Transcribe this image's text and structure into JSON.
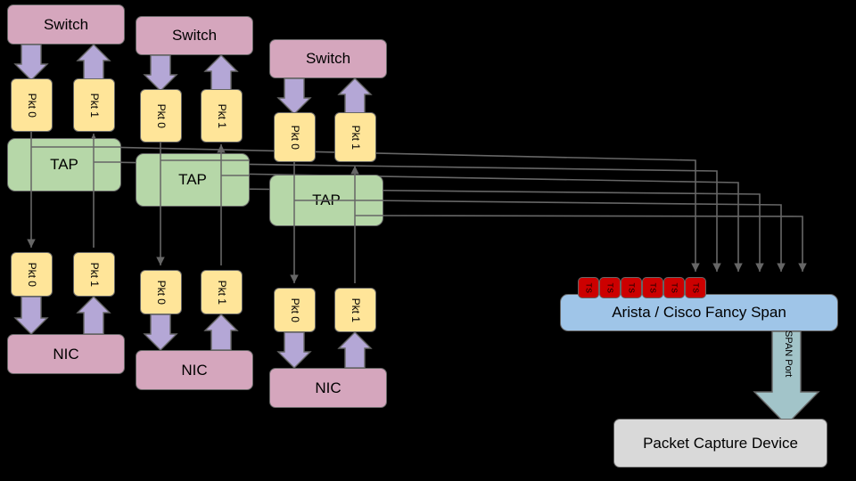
{
  "diagram": {
    "title": "Network TAP and SPAN packet capture topology",
    "background": "#000000",
    "colors": {
      "switch_nic": "#d5a6bd",
      "tap": "#b6d7a8",
      "packet": "#ffe599",
      "span_device": "#9fc5e8",
      "capture_device": "#d9d9d9",
      "port": "#cc0000",
      "purple_arrow": "#b4a7d6",
      "teal_arrow": "#a2c4c9",
      "wire": "#666666",
      "stroke": "#666666"
    }
  },
  "labels": {
    "switch": "Switch",
    "nic": "NIC",
    "tap": "TAP",
    "pkt0": "Pkt 0",
    "pkt1": "Pkt 1",
    "span_device": "Arista / Cisco Fancy Span",
    "capture_device": "Packet Capture Device",
    "span_port": "SPAN Port",
    "port_ts": "TS"
  },
  "columns": [
    {
      "id": "col-1",
      "switch": "Switch",
      "tap": "TAP",
      "nic": "NIC",
      "top_pkt0": "Pkt 0",
      "top_pkt1": "Pkt 1",
      "bottom_pkt0": "Pkt 0",
      "bottom_pkt1": "Pkt 1"
    },
    {
      "id": "col-2",
      "switch": "Switch",
      "tap": "TAP",
      "nic": "NIC",
      "top_pkt0": "Pkt 0",
      "top_pkt1": "Pkt 1",
      "bottom_pkt0": "Pkt 0",
      "bottom_pkt1": "Pkt 1"
    },
    {
      "id": "col-3",
      "switch": "Switch",
      "tap": "TAP",
      "nic": "NIC",
      "top_pkt0": "Pkt 0",
      "top_pkt1": "Pkt 1",
      "bottom_pkt0": "Pkt 0",
      "bottom_pkt1": "Pkt 1"
    }
  ],
  "span": {
    "device_label": "Arista / Cisco Fancy Span",
    "port_count": 6,
    "ports": [
      {
        "label": "TS"
      },
      {
        "label": "TS"
      },
      {
        "label": "TS"
      },
      {
        "label": "TS"
      },
      {
        "label": "TS"
      },
      {
        "label": "TS"
      }
    ],
    "downlink_label": "SPAN Port",
    "capture_label": "Packet Capture Device"
  }
}
